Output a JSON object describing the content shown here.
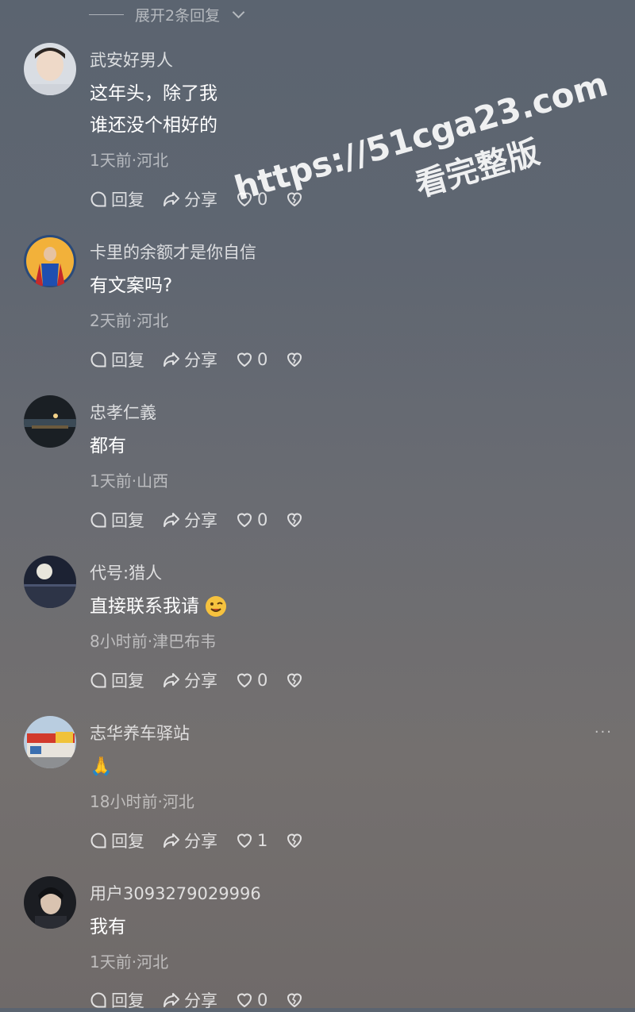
{
  "expand_replies": "展开2条回复",
  "labels": {
    "reply": "回复",
    "share": "分享"
  },
  "comments": [
    {
      "user": "武安好男人",
      "text_lines": [
        "这年头，除了我",
        "谁还没个相好的"
      ],
      "meta": "1天前·河北",
      "likes": "0"
    },
    {
      "user": "卡里的余额才是你自信",
      "text_lines": [
        "有文案吗?"
      ],
      "meta": "2天前·河北",
      "likes": "0"
    },
    {
      "user": "忠孝仁義",
      "text_lines": [
        "都有"
      ],
      "meta": "1天前·山西",
      "likes": "0"
    },
    {
      "user": "代号:猎人",
      "text_lines": [
        "直接联系我请"
      ],
      "meta": "8小时前·津巴布韦",
      "likes": "0"
    },
    {
      "user": "志华养车驿站",
      "text_lines": [
        "🙏"
      ],
      "meta": "18小时前·河北",
      "likes": "1"
    },
    {
      "user": "用户3093279029996",
      "text_lines": [
        "我有"
      ],
      "meta": "1天前·河北",
      "likes": "0"
    }
  ],
  "watermark": {
    "line1": "https://51cga23.com",
    "line2": "看完整版"
  },
  "more_menu": "···"
}
